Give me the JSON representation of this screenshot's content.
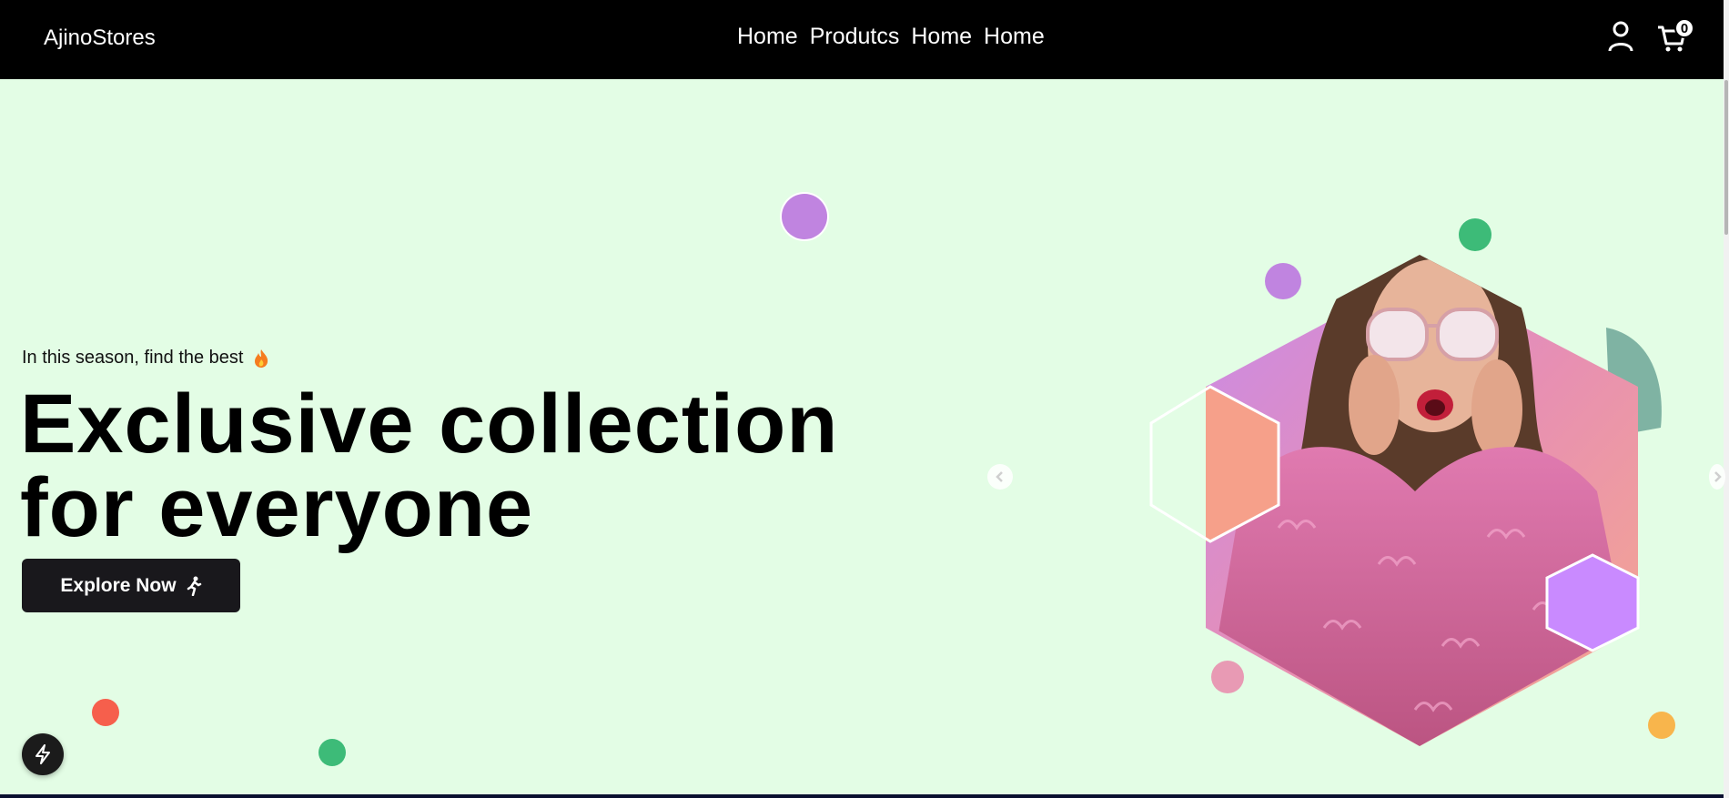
{
  "header": {
    "brand": "AjinoStores",
    "nav": [
      "Home",
      "Produtcs",
      "Home",
      "Home"
    ],
    "cart_count": "0",
    "icons": [
      "user-icon",
      "cart-icon"
    ]
  },
  "hero": {
    "tagline": "In this season, find the best",
    "tagline_icon": "fire-icon",
    "headline_line1": "Exclusive collection",
    "headline_line2": "for everyone",
    "button_label": "Explore Now",
    "button_icon": "running-person-icon"
  },
  "colors": {
    "page_bg": "#e3fde5",
    "header_bg": "#000000",
    "button_bg": "#19181c",
    "purple": "#c084e0",
    "green": "#3dbb78",
    "coral": "#f65f4c",
    "orange": "#f8b54c",
    "pink": "#e89ab4"
  }
}
